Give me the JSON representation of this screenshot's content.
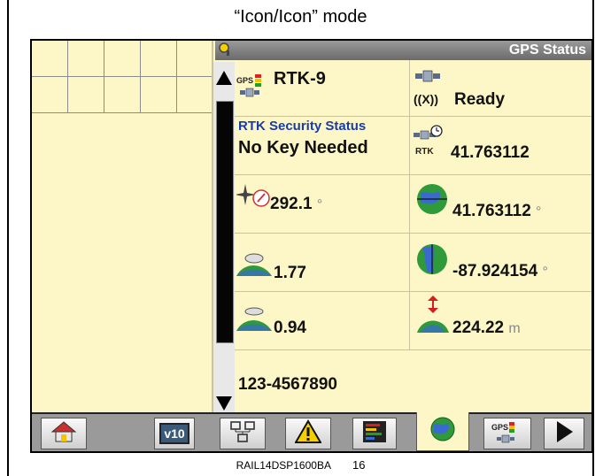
{
  "caption": "“Icon/Icon” mode",
  "footer": {
    "code": "RAIL14DSP1600BA",
    "page": "16"
  },
  "titlebar": {
    "title": "GPS Status"
  },
  "cells": {
    "gps_mode": {
      "label_small": "GPS",
      "value": "RTK-9"
    },
    "receiver_status": {
      "radio_symbol": "((X))",
      "value": "Ready"
    },
    "rtk_security": {
      "title": "RTK Security Status",
      "value": "No Key Needed"
    },
    "rtk_value": {
      "label_small": "RTK",
      "value": "41.763112"
    },
    "heading": {
      "value": "292.1",
      "unit": "°"
    },
    "latitude": {
      "value": "41.763112",
      "unit": "°"
    },
    "pdop": {
      "value": "1.77"
    },
    "longitude": {
      "value": "-87.924154",
      "unit": "°"
    },
    "hdop": {
      "value": "0.94"
    },
    "altitude": {
      "value": "224.22",
      "unit": "m"
    },
    "serial": {
      "value": "123-4567890"
    }
  },
  "toolbar": {
    "buttons": [
      {
        "name": "home-button",
        "icon": "home-icon"
      },
      {
        "name": "version-button",
        "icon": "v10-icon",
        "label": "v10"
      },
      {
        "name": "network-button",
        "icon": "network-icon"
      },
      {
        "name": "warning-button",
        "icon": "warning-icon"
      },
      {
        "name": "chart-button",
        "icon": "bar-chart-icon"
      },
      {
        "name": "globe-tab-button",
        "icon": "globe-icon"
      },
      {
        "name": "gps-button",
        "icon": "gps-satellite-icon",
        "label": "GPS"
      },
      {
        "name": "next-page-button",
        "icon": "play-arrow-icon"
      }
    ]
  },
  "colors": {
    "screen_bg": "#fdf6c6",
    "titlebar": "#7a7a7a",
    "accent_blue": "#1a3ca8",
    "globe_green": "#2e9a3a"
  }
}
